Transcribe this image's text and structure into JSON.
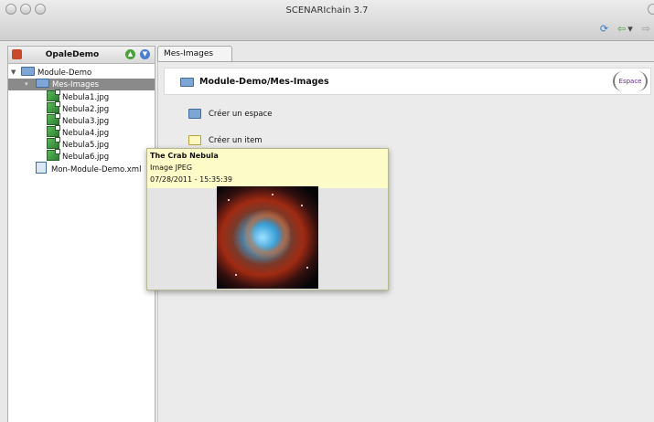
{
  "window": {
    "title": "SCENARIchain 3.7"
  },
  "toolbar": {
    "icons": [
      "sync-icon",
      "back-arrow-icon",
      "forward-arrow-icon"
    ]
  },
  "left_panel": {
    "title": "OpaleDemo",
    "tree": {
      "root": "Module-Demo",
      "folder": "Mes-Images",
      "files": [
        "Nebula1.jpg",
        "Nebula2.jpg",
        "Nebula3.jpg",
        "Nebula4.jpg",
        "Nebula5.jpg",
        "Nebula6.jpg"
      ],
      "xml": "Mon-Module-Demo.xml"
    }
  },
  "tab": {
    "label": "Mes-Images"
  },
  "content": {
    "path": "Module-Demo/Mes-Images",
    "espace_button": "Espace",
    "actions": {
      "create_space": "Créer un espace",
      "create_item": "Créer un item"
    }
  },
  "tooltip": {
    "title": "The Crab Nebula",
    "type": "Image JPEG",
    "date": "07/28/2011 - 15:35:39"
  },
  "colors": {
    "tooltip_bg": "#fdfbc8",
    "selection": "#8a8a8a",
    "espace_text": "#6a2b8a"
  }
}
